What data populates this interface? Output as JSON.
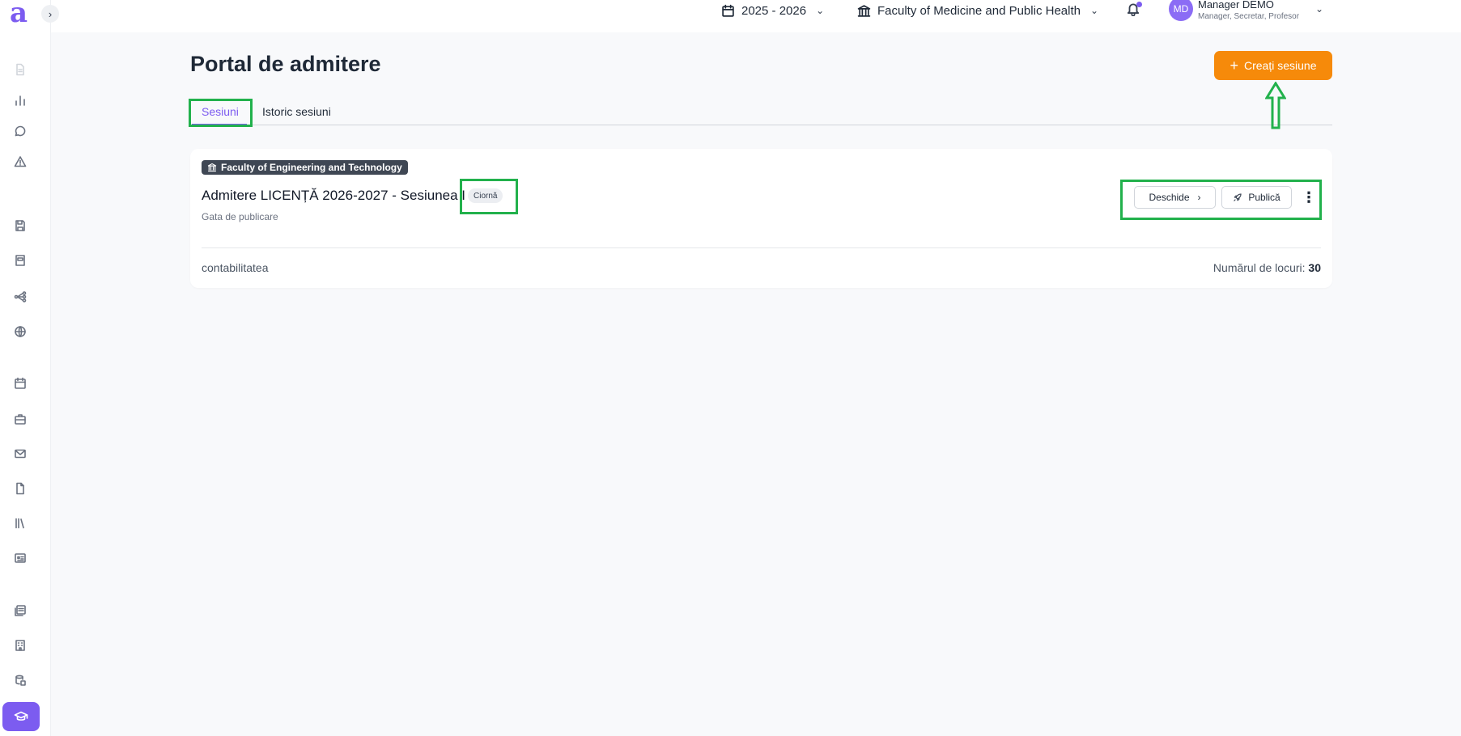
{
  "sidebar": {
    "logo": "a",
    "collapse_icon": "chevron-right-icon",
    "items": [
      {
        "icon": "document-icon",
        "faded": true
      },
      {
        "icon": "bar-chart-icon"
      },
      {
        "icon": "chat-icon"
      },
      {
        "icon": "warning-icon"
      },
      {
        "icon": "save-icon"
      },
      {
        "icon": "book-icon"
      },
      {
        "icon": "workflow-icon"
      },
      {
        "icon": "globe-icon"
      },
      {
        "icon": "calendar-icon"
      },
      {
        "icon": "briefcase-icon"
      },
      {
        "icon": "mail-icon"
      },
      {
        "icon": "file-icon"
      },
      {
        "icon": "library-icon"
      },
      {
        "icon": "id-card-icon"
      },
      {
        "icon": "reports-icon"
      },
      {
        "icon": "building-icon"
      },
      {
        "icon": "database-icon"
      },
      {
        "icon": "graduation-cap-icon",
        "active": true
      }
    ]
  },
  "topbar": {
    "year": "2025 - 2026",
    "faculty": "Faculty of Medicine and Public Health",
    "user": {
      "initials": "MD",
      "name": "Manager DEMO",
      "roles": "Manager, Secretar, Profesor"
    }
  },
  "page": {
    "title": "Portal de admitere",
    "create_button": "Creați sesiune",
    "tabs": [
      {
        "label": "Sesiuni",
        "active": true
      },
      {
        "label": "Istoric sesiuni",
        "active": false
      }
    ]
  },
  "session_card": {
    "faculty": "Faculty of Engineering and Technology",
    "title": "Admitere LICENȚĂ 2026-2027 - Sesiunea I",
    "status": "Ciornă",
    "subtitle": "Gata de publicare",
    "open_button": "Deschide",
    "publish_button": "Publică",
    "department": "contabilitatea",
    "places_label": "Numărul de locuri:",
    "places_value": "30"
  },
  "colors": {
    "accent": "#7c5cf0",
    "primary_button": "#f68a0a",
    "highlight": "#22b14c"
  }
}
